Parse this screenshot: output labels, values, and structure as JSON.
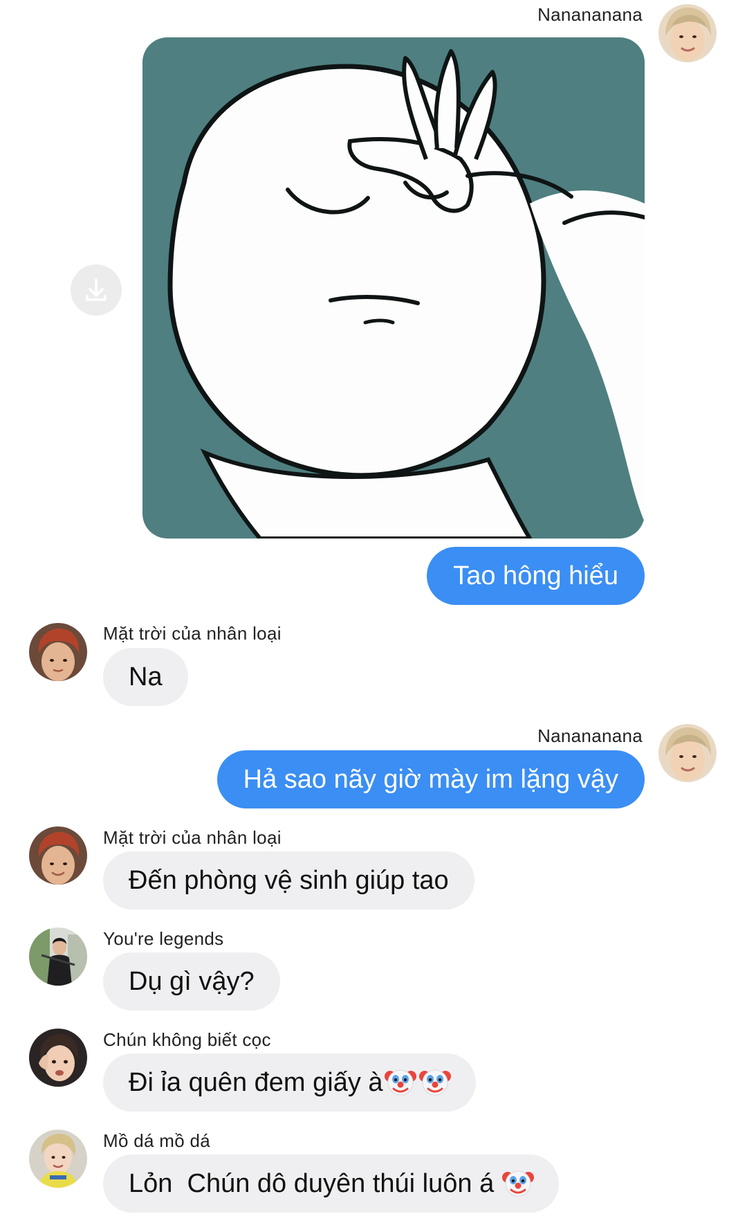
{
  "current_user": {
    "name": "Nanananana"
  },
  "messages": [
    {
      "type": "image",
      "sender": "Nanananana",
      "direction": "outgoing",
      "image_description": "facepalm-meme",
      "download_icon": "download-icon"
    },
    {
      "type": "text",
      "sender": "Nanananana",
      "direction": "outgoing",
      "text": "Tao hông hiểu"
    },
    {
      "type": "text",
      "sender": "Mặt trời của nhân loại",
      "direction": "incoming",
      "text": "Na"
    },
    {
      "type": "text",
      "sender": "Nanananana",
      "direction": "outgoing",
      "text": "Hả sao nãy giờ mày im lặng vậy"
    },
    {
      "type": "text",
      "sender": "Mặt trời của nhân loại",
      "direction": "incoming",
      "text": "Đến phòng vệ sinh giúp tao"
    },
    {
      "type": "text",
      "sender": "You're legends",
      "direction": "incoming",
      "text": "Dụ gì vậy?"
    },
    {
      "type": "text",
      "sender": "Chún không biết cọc",
      "direction": "incoming",
      "text": "Đi ỉa quên đem giấy à",
      "emojis": [
        "clown-face-emoji",
        "clown-face-emoji"
      ]
    },
    {
      "type": "text",
      "sender": "Mồ dá mồ dá",
      "direction": "incoming",
      "text": "Lỏn  Chún dô duyên thúi luôn á",
      "emojis": [
        "clown-face-emoji"
      ]
    }
  ],
  "colors": {
    "outgoing_bubble": "#3b8ef3",
    "incoming_bubble": "#efeff1",
    "meme_background": "#4f7f80"
  }
}
